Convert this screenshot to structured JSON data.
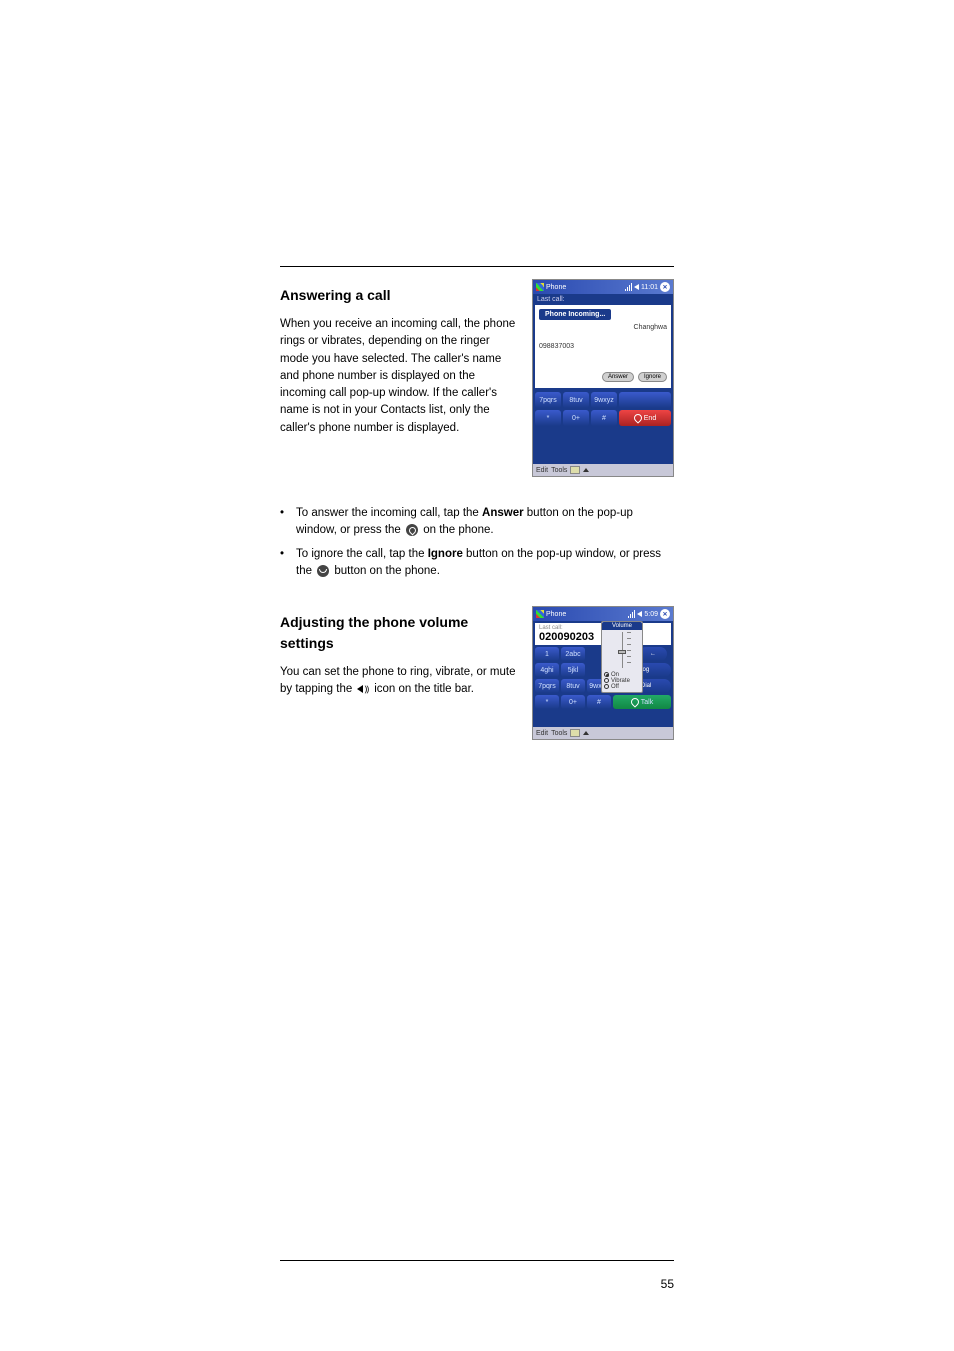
{
  "page_number": "55",
  "section1": {
    "heading": "Answering a call",
    "para1": "When you receive an incoming call, the phone rings or vibrates, depending on the ringer mode you have selected. The caller's name and phone number is displayed on the incoming call pop-up window. If the caller's name is not in your Contacts list, only the caller's phone number is displayed.",
    "bullet1_start": "To answer the incoming call, tap the ",
    "bullet1_bold": "Answer",
    "bullet1_mid": " button on the pop-up window, or press the ",
    "bullet1_end": " on the phone.",
    "bullet2_start": "To ignore the call, tap the ",
    "bullet2_bold": "Ignore",
    "bullet2_mid": " button on the pop-up window, or press the ",
    "bullet2_end": " button on the phone."
  },
  "section2": {
    "heading": "Adjusting the phone volume settings",
    "para1_a": "You can set the phone to ring, vibrate, or mute by tapping the ",
    "para1_b": " icon on the title bar."
  },
  "screenshot1": {
    "title": "Phone",
    "time": "11:01",
    "tab_label": "Phone    Incoming...",
    "caller_name": "Changhwa",
    "caller_number": "098837003",
    "answer": "Answer",
    "ignore": "Ignore",
    "keys": [
      "7pqrs",
      "8tuv",
      "9wxyz",
      "*",
      "0+",
      "#"
    ],
    "end_label": "End",
    "bottom_left": "Edit",
    "bottom_tools": "Tools"
  },
  "screenshot2": {
    "title": "Phone",
    "time": "5:09",
    "last_call_label": "Last call:",
    "number": "020090203",
    "volume_label": "Volume",
    "radio_on": "On",
    "radio_vibrate": "Vibrate",
    "radio_off": "Off",
    "right_buttons": [
      "←",
      "ll Log",
      "ed Dial"
    ],
    "row1": [
      "1",
      "2abc"
    ],
    "row2": [
      "4ghi",
      "5jkl"
    ],
    "row3": [
      "7pqrs",
      "8tuv",
      "9wxyz"
    ],
    "row4": [
      "*",
      "0+",
      "#"
    ],
    "talk_label": "Talk",
    "bottom_left": "Edit",
    "bottom_tools": "Tools"
  }
}
